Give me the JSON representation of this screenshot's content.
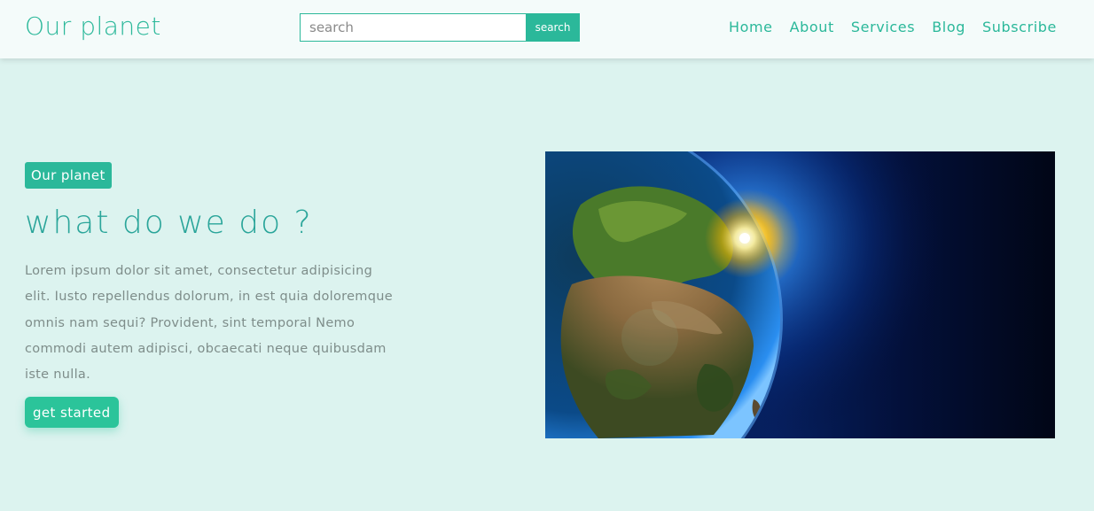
{
  "header": {
    "logo": "Our planet",
    "search": {
      "placeholder": "search",
      "value": "",
      "button_label": "search"
    },
    "nav": [
      "Home",
      "About",
      "Services",
      "Blog",
      "Subscribe"
    ]
  },
  "hero": {
    "badge": "Our planet",
    "title": "what do we do ?",
    "text": "Lorem ipsum dolor sit amet, consectetur adipisicing elit. Iusto repellendus dolorum, in est quia doloremque omnis nam sequi? Provident, sint temporal Nemo commodi autem adipisci, obcaecati neque quibusdam iste nulla.",
    "cta_label": "get started",
    "image_icon": "earth-from-space-image"
  },
  "colors": {
    "accent": "#2bb89a",
    "page_background": "#dcf3ef",
    "header_background": "#f4fbfa",
    "body_text": "#7e8d8a"
  }
}
